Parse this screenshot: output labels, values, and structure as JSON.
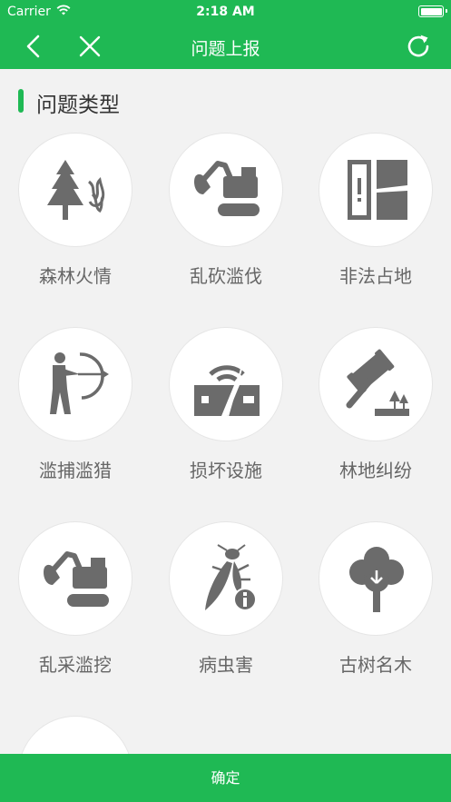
{
  "status_bar": {
    "carrier": "Carrier",
    "time": "2:18 AM"
  },
  "nav": {
    "title": "问题上报",
    "back_icon": "chevron-left-icon",
    "close_icon": "close-icon",
    "refresh_icon": "refresh-icon"
  },
  "section": {
    "title": "问题类型"
  },
  "categories": [
    {
      "label": "森林火情",
      "icon": "forest-fire-icon"
    },
    {
      "label": "乱砍滥伐",
      "icon": "excavator-icon"
    },
    {
      "label": "非法占地",
      "icon": "land-occupation-icon"
    },
    {
      "label": "滥捕滥猎",
      "icon": "archer-icon"
    },
    {
      "label": "损坏设施",
      "icon": "broken-facility-icon"
    },
    {
      "label": "林地纠纷",
      "icon": "gavel-icon"
    },
    {
      "label": "乱采滥挖",
      "icon": "digger-icon"
    },
    {
      "label": "病虫害",
      "icon": "pest-icon"
    },
    {
      "label": "古树名木",
      "icon": "ancient-tree-icon"
    }
  ],
  "confirm_label": "确定",
  "colors": {
    "accent": "#1fb954",
    "icon": "#6b6b6b",
    "background": "#f2f2f2"
  }
}
